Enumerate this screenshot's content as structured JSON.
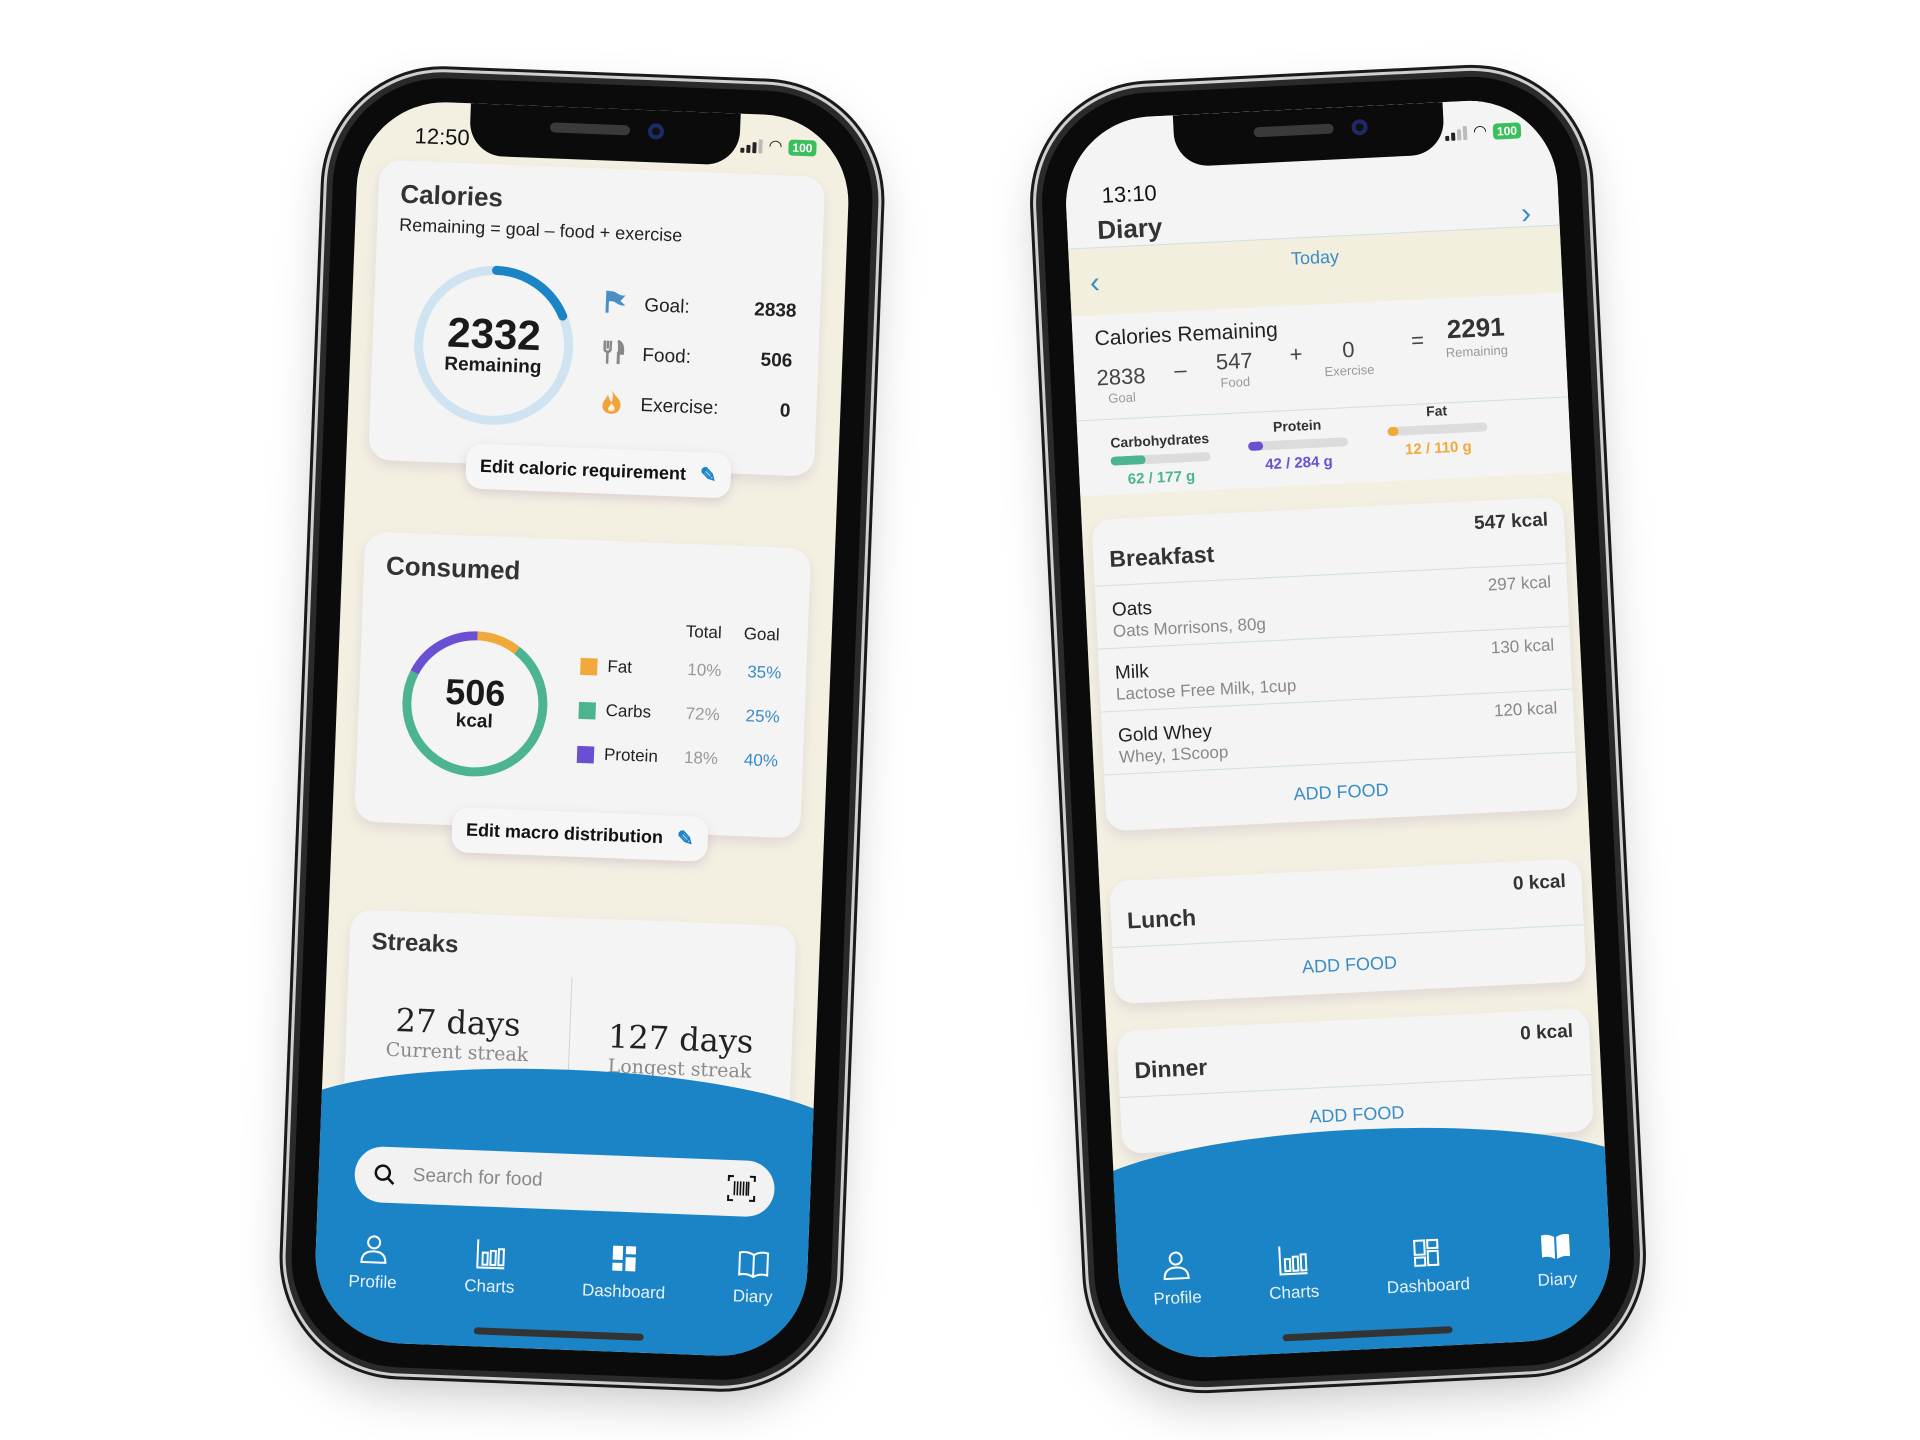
{
  "dashboard": {
    "status": {
      "time": "12:50",
      "battery": "100"
    },
    "calories": {
      "title": "Calories",
      "formula": "Remaining = goal – food + exercise",
      "remaining_value": "2332",
      "remaining_label": "Remaining",
      "progress_fraction": 0.18,
      "stats": [
        {
          "icon": "flag-icon",
          "label": "Goal:",
          "value": "2838"
        },
        {
          "icon": "fork-knife-icon",
          "label": "Food:",
          "value": "506"
        },
        {
          "icon": "flame-icon",
          "label": "Exercise:",
          "value": "0"
        }
      ],
      "edit_label": "Edit caloric requirement"
    },
    "consumed": {
      "title": "Consumed",
      "value": "506",
      "unit": "kcal",
      "col_total": "Total",
      "col_goal": "Goal",
      "macros": [
        {
          "name": "Fat",
          "total": "10%",
          "goal": "35%",
          "color": "#f2a93b",
          "fraction": 0.1
        },
        {
          "name": "Carbs",
          "total": "72%",
          "goal": "25%",
          "color": "#4cb58f",
          "fraction": 0.72
        },
        {
          "name": "Protein",
          "total": "18%",
          "goal": "40%",
          "color": "#6a4fd3",
          "fraction": 0.18
        }
      ],
      "edit_label": "Edit macro distribution"
    },
    "streaks": {
      "title": "Streaks",
      "current_value": "27 days",
      "current_label": "Current streak",
      "longest_value": "127 days",
      "longest_label": "Longest streak"
    },
    "search": {
      "placeholder": "Search for food"
    },
    "nav": [
      {
        "label": "Profile",
        "icon": "person-icon"
      },
      {
        "label": "Charts",
        "icon": "bar-chart-icon"
      },
      {
        "label": "Dashboard",
        "icon": "dashboard-icon"
      },
      {
        "label": "Diary",
        "icon": "book-icon"
      }
    ]
  },
  "diary": {
    "status": {
      "time": "13:10",
      "battery": "100"
    },
    "title": "Diary",
    "date_label": "Today",
    "summary": {
      "title": "Calories Remaining",
      "goal": "2838",
      "goal_label": "Goal",
      "food": "547",
      "food_label": "Food",
      "exercise": "0",
      "exercise_label": "Exercise",
      "remaining": "2291",
      "remaining_label": "Remaining",
      "op_minus": "–",
      "op_plus": "+",
      "op_equals": "="
    },
    "macros": [
      {
        "name": "Carbohydrates",
        "value": "62 / 177 g",
        "fraction": 0.35,
        "color": "#4cb58f"
      },
      {
        "name": "Protein",
        "value": "42 / 284 g",
        "fraction": 0.15,
        "color": "#6a4fd3"
      },
      {
        "name": "Fat",
        "value": "12 / 110 g",
        "fraction": 0.11,
        "color": "#f2a93b"
      }
    ],
    "meals": [
      {
        "name": "Breakfast",
        "kcal": "547 kcal",
        "foods": [
          {
            "name": "Oats",
            "desc": "Oats Morrisons, 80g",
            "kcal": "297 kcal"
          },
          {
            "name": "Milk",
            "desc": "Lactose Free Milk, 1cup",
            "kcal": "130 kcal"
          },
          {
            "name": "Gold Whey",
            "desc": "Whey, 1Scoop",
            "kcal": "120 kcal"
          }
        ],
        "add_label": "ADD FOOD"
      },
      {
        "name": "Lunch",
        "kcal": "0 kcal",
        "foods": [],
        "add_label": "ADD FOOD"
      },
      {
        "name": "Dinner",
        "kcal": "0 kcal",
        "foods": [],
        "add_label": "ADD FOOD"
      }
    ],
    "nav": [
      {
        "label": "Profile",
        "icon": "person-icon"
      },
      {
        "label": "Charts",
        "icon": "bar-chart-icon"
      },
      {
        "label": "Dashboard",
        "icon": "dashboard-icon"
      },
      {
        "label": "Diary",
        "icon": "book-icon"
      }
    ]
  }
}
